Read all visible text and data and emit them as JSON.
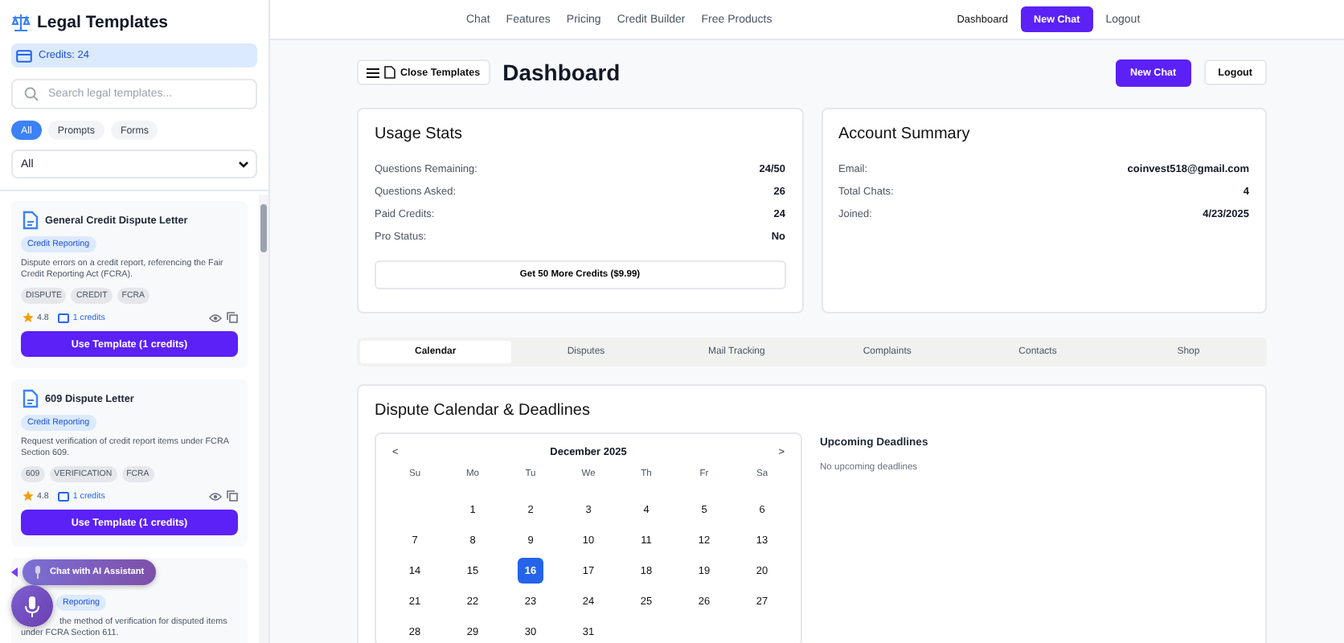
{
  "sidebar": {
    "title": "Legal Templates",
    "credits": "Credits: 24",
    "search": {
      "placeholder": "Search legal templates..."
    },
    "filters": [
      {
        "label": "All",
        "selected": true
      },
      {
        "label": "Prompts",
        "selected": false
      },
      {
        "label": "Forms",
        "selected": false
      }
    ],
    "category_select": {
      "value": "All"
    },
    "templates": [
      {
        "kind": "full",
        "title": "General Credit Dispute Letter",
        "category": "Credit Reporting",
        "description": "Dispute errors on a credit report, referencing the Fair Credit Reporting Act (FCRA).",
        "tags": [
          "DISPUTE",
          "CREDIT",
          "FCRA"
        ],
        "rating": "4.8",
        "credits": "1 credits",
        "button": "Use Template (1 credits)"
      },
      {
        "kind": "full",
        "title": "609 Dispute Letter",
        "category": "Credit Reporting",
        "description": "Request verification of credit report items under FCRA Section 609.",
        "tags": [
          "609",
          "VERIFICATION",
          "FCRA"
        ],
        "rating": "4.8",
        "credits": "1 credits",
        "button": "Use Template (1 credits)"
      },
      {
        "kind": "covered",
        "category": "Reporting",
        "description": "the method of verification for disputed items under FCRA Section 611."
      }
    ]
  },
  "chat_assistant": {
    "label": "Chat with AI Assistant"
  },
  "nav": {
    "links": [
      "Chat",
      "Features",
      "Pricing",
      "Credit Builder",
      "Free Products"
    ],
    "dashboard": "Dashboard",
    "new_chat": "New Chat",
    "logout": "Logout"
  },
  "header": {
    "toggle": "Close Templates",
    "title": "Dashboard",
    "new_chat": "New Chat",
    "logout": "Logout"
  },
  "usage_stats": {
    "title": "Usage Stats",
    "rows": [
      {
        "label": "Questions Remaining:",
        "value": "24/50"
      },
      {
        "label": "Questions Asked:",
        "value": "26"
      },
      {
        "label": "Paid Credits:",
        "value": "24"
      },
      {
        "label": "Pro Status:",
        "value": "No"
      }
    ],
    "button": "Get 50 More Credits ($9.99)"
  },
  "account_summary": {
    "title": "Account Summary",
    "rows": [
      {
        "label": "Email:",
        "value": "coinvest518@gmail.com"
      },
      {
        "label": "Total Chats:",
        "value": "4"
      },
      {
        "label": "Joined:",
        "value": "4/23/2025"
      }
    ]
  },
  "tabs": [
    {
      "label": "Calendar",
      "selected": true
    },
    {
      "label": "Disputes",
      "selected": false
    },
    {
      "label": "Mail Tracking",
      "selected": false
    },
    {
      "label": "Complaints",
      "selected": false
    },
    {
      "label": "Contacts",
      "selected": false
    },
    {
      "label": "Shop",
      "selected": false
    }
  ],
  "calendar_panel": {
    "title": "Dispute Calendar & Deadlines",
    "calendar": {
      "prev": "<",
      "month": "December 2025",
      "next": ">",
      "weekdays": [
        "Su",
        "Mo",
        "Tu",
        "We",
        "Th",
        "Fr",
        "Sa"
      ],
      "weeks": [
        {
          "days": [
            {
              "kind": "blank"
            },
            {
              "kind": "day",
              "label": "1",
              "selected": false
            },
            {
              "label": "2",
              "selected": false
            },
            {
              "label": "3",
              "selected": false
            },
            {
              "label": "4",
              "selected": false
            },
            {
              "label": "5",
              "selected": false
            },
            {
              "label": "6",
              "selected": false
            }
          ]
        },
        {
          "days": [
            {
              "label": "7",
              "selected": false
            },
            {
              "label": "8",
              "selected": false
            },
            {
              "label": "9",
              "selected": false
            },
            {
              "label": "10",
              "selected": false
            },
            {
              "label": "11",
              "selected": false
            },
            {
              "label": "12",
              "selected": false
            },
            {
              "label": "13",
              "selected": false
            }
          ]
        },
        {
          "days": [
            {
              "label": "14",
              "selected": false
            },
            {
              "label": "15",
              "selected": false
            },
            {
              "label": "16",
              "selected": true
            },
            {
              "label": "17",
              "selected": false
            },
            {
              "label": "18",
              "selected": false
            },
            {
              "label": "19",
              "selected": false
            },
            {
              "label": "20",
              "selected": false
            }
          ]
        },
        {
          "days": [
            {
              "label": "21",
              "selected": false
            },
            {
              "label": "22",
              "selected": false
            },
            {
              "label": "23",
              "selected": false
            },
            {
              "label": "24",
              "selected": false
            },
            {
              "label": "25",
              "selected": false
            },
            {
              "label": "26",
              "selected": false
            },
            {
              "label": "27",
              "selected": false
            }
          ]
        },
        {
          "days": [
            {
              "label": "28",
              "selected": false
            },
            {
              "label": "29",
              "selected": false
            },
            {
              "label": "30",
              "selected": false
            },
            {
              "label": "31",
              "selected": false
            }
          ]
        }
      ]
    },
    "deadlines": {
      "title": "Upcoming Deadlines",
      "empty_text": "No upcoming deadlines"
    }
  }
}
